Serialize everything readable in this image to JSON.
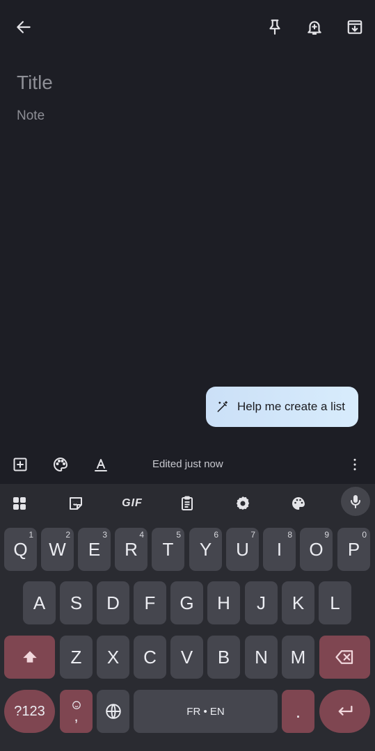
{
  "note": {
    "title_placeholder": "Title",
    "body_placeholder": "Note"
  },
  "toolbar": {
    "icons": [
      "back-arrow-icon",
      "pin-icon",
      "reminder-bell-icon",
      "archive-icon"
    ]
  },
  "assist": {
    "label": "Help me create a list",
    "icon": "magic-wand-icon"
  },
  "bottom_bar": {
    "status": "Edited just now",
    "icons": [
      "add-box-icon",
      "palette-icon",
      "text-format-icon",
      "more-vert-icon"
    ]
  },
  "keyboard": {
    "tools": [
      "apps-grid-icon",
      "sticker-icon",
      "GIF",
      "clipboard-icon",
      "settings-gear-icon",
      "theme-palette-icon",
      "mic-icon"
    ],
    "gif_label": "GIF",
    "row1": [
      {
        "k": "Q",
        "n": "1"
      },
      {
        "k": "W",
        "n": "2"
      },
      {
        "k": "E",
        "n": "3"
      },
      {
        "k": "R",
        "n": "4"
      },
      {
        "k": "T",
        "n": "5"
      },
      {
        "k": "Y",
        "n": "6"
      },
      {
        "k": "U",
        "n": "7"
      },
      {
        "k": "I",
        "n": "8"
      },
      {
        "k": "O",
        "n": "9"
      },
      {
        "k": "P",
        "n": "0"
      }
    ],
    "row2": [
      "A",
      "S",
      "D",
      "F",
      "G",
      "H",
      "J",
      "K",
      "L"
    ],
    "row3": [
      "Z",
      "X",
      "C",
      "V",
      "B",
      "N",
      "M"
    ],
    "symbols_label": "?123",
    "comma_label": ",",
    "space_label": "FR • EN",
    "period_label": ".",
    "accent_color": "#7f4651",
    "key_color": "#45464e"
  }
}
